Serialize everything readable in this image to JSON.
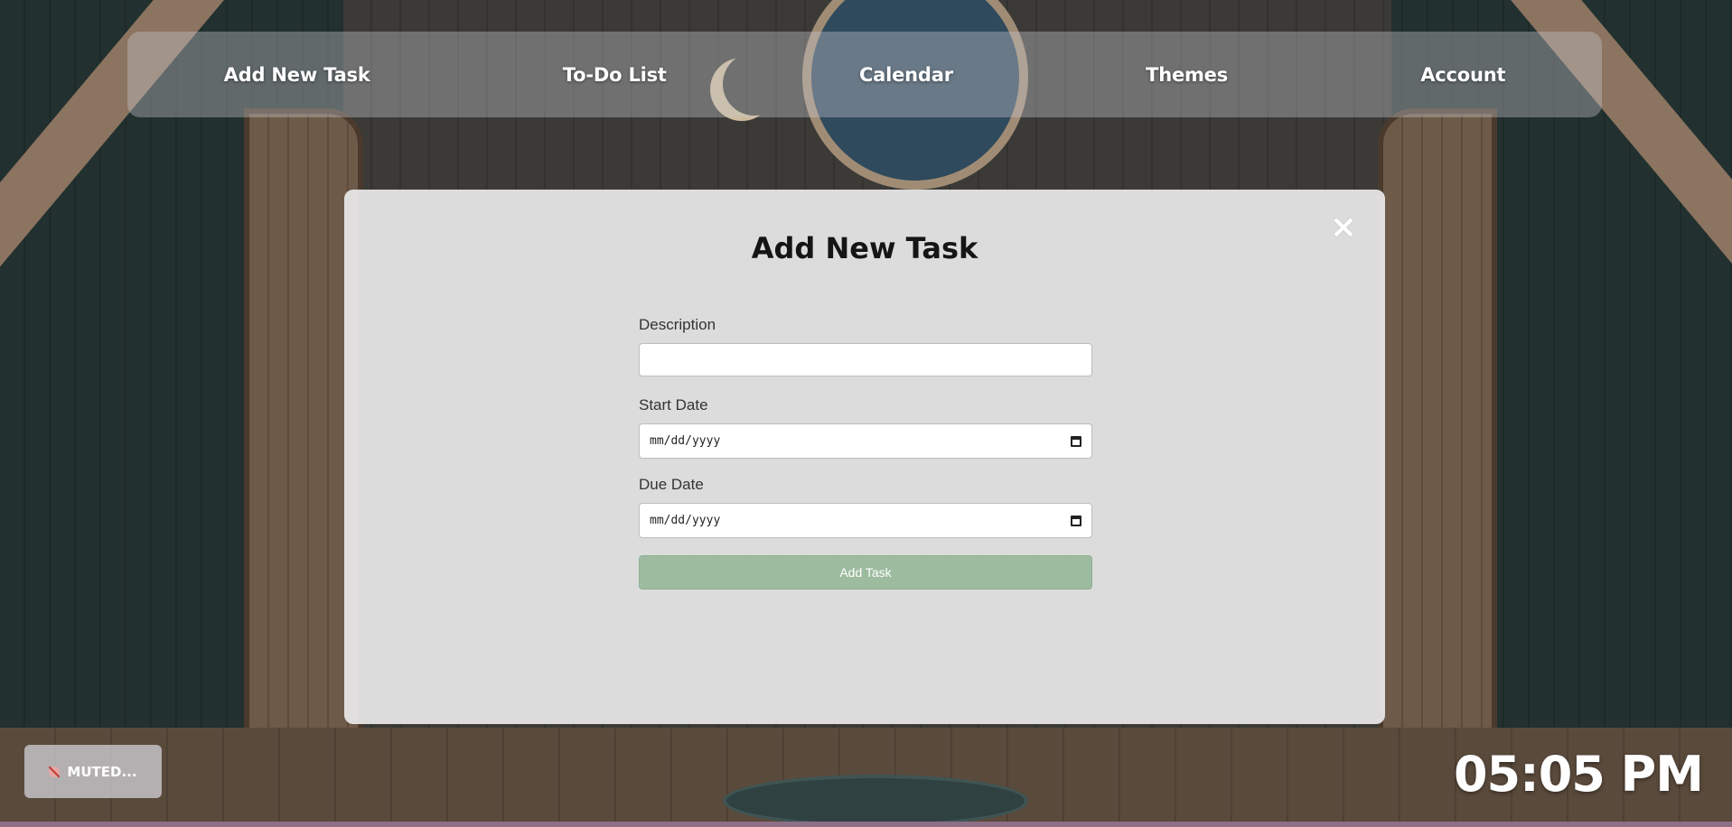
{
  "nav": {
    "items": [
      {
        "label": "Add New Task"
      },
      {
        "label": "To-Do List"
      },
      {
        "label": "Calendar"
      },
      {
        "label": "Themes"
      },
      {
        "label": "Account"
      }
    ]
  },
  "modal": {
    "title": "Add New Task",
    "close_icon": "×",
    "fields": {
      "description": {
        "label": "Description",
        "value": ""
      },
      "start_date": {
        "label": "Start Date",
        "value": "mm/dd/yyyy"
      },
      "due_date": {
        "label": "Due Date",
        "value": "mm/dd/yyyy"
      }
    },
    "submit_label": "Add Task"
  },
  "audio": {
    "label": "MUTED..."
  },
  "clock": {
    "time": "05:05 PM"
  },
  "colors": {
    "submit_button": "#9dbb9f",
    "navbar": "rgba(200,200,205,0.38)",
    "modal": "rgba(234,234,236,0.92)",
    "bottom_strip": "#8e6f86"
  }
}
